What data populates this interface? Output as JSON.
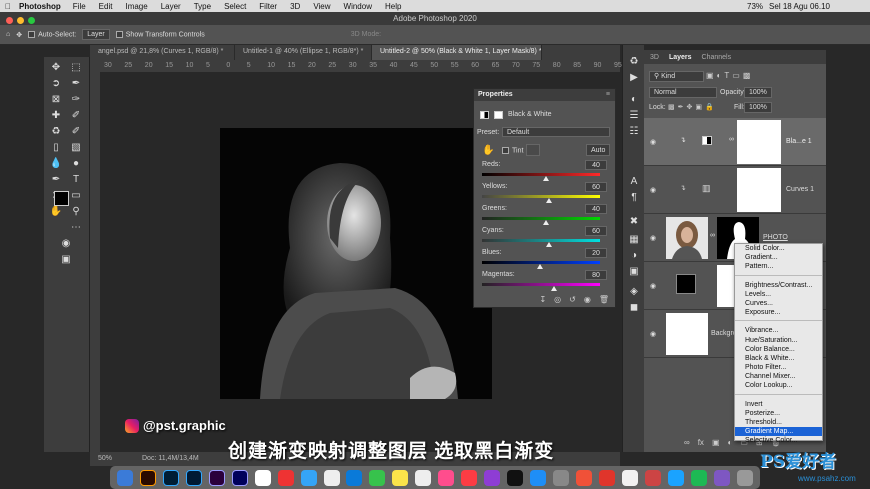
{
  "menubar": {
    "app": "Photoshop",
    "items": [
      "File",
      "Edit",
      "Image",
      "Layer",
      "Type",
      "Select",
      "Filter",
      "3D",
      "View",
      "Window",
      "Help"
    ],
    "battery": "73%",
    "datetime": "Sel 18 Agu 06.10"
  },
  "titlebar": "Adobe Photoshop 2020",
  "options": {
    "auto_select": "Auto-Select:",
    "layer_select": "Layer",
    "transform": "Show Transform Controls",
    "mode": "3D Mode:"
  },
  "tabs": [
    "angel.psd @ 21,8% (Curves 1, RGB/8) *",
    "Untitled-1 @ 40% (Ellipse 1, RGB/8*) *",
    "Untitled-2 @ 50% (Black & White 1, Layer Mask/8) *"
  ],
  "ruler": [
    "30",
    "25",
    "20",
    "15",
    "10",
    "5",
    "0",
    "5",
    "10",
    "15",
    "20",
    "25",
    "30",
    "35",
    "40",
    "45",
    "50",
    "55",
    "60",
    "65",
    "70",
    "75",
    "80",
    "85",
    "90",
    "95"
  ],
  "properties": {
    "title": "Properties",
    "adjustment": "Black & White",
    "preset_label": "Preset:",
    "preset_value": "Default",
    "tint": "Tint",
    "auto": "Auto",
    "sliders": [
      {
        "name": "Reds:",
        "value": "40"
      },
      {
        "name": "Yellows:",
        "value": "60"
      },
      {
        "name": "Greens:",
        "value": "40"
      },
      {
        "name": "Cyans:",
        "value": "60"
      },
      {
        "name": "Blues:",
        "value": "20"
      },
      {
        "name": "Magentas:",
        "value": "80"
      }
    ],
    "slider_fraction": [
      0.54,
      0.57,
      0.54,
      0.57,
      0.49,
      0.61
    ]
  },
  "layers": {
    "tab3d": "3D",
    "tab_layers": "Layers",
    "tab_channels": "Channels",
    "kind": "Kind",
    "blend": "Normal",
    "opacity_label": "Opacity:",
    "opacity": "100%",
    "lock": "Lock:",
    "fill_label": "Fill:",
    "fill": "100%",
    "rows": [
      {
        "name": "Bla...e 1"
      },
      {
        "name": "Curves 1"
      },
      {
        "name": "PHOTO"
      },
      {
        "name": ""
      },
      {
        "name": "Backgro"
      }
    ]
  },
  "context_menu": {
    "items": [
      "Solid Color...",
      "Gradient...",
      "Pattern...",
      "-",
      "Brightness/Contrast...",
      "Levels...",
      "Curves...",
      "Exposure...",
      "-",
      "Vibrance...",
      "Hue/Saturation...",
      "Color Balance...",
      "Black & White...",
      "Photo Filter...",
      "Channel Mixer...",
      "Color Lookup...",
      "-",
      "Invert",
      "Posterize...",
      "Threshold...",
      "Gradient Map...",
      "Selective Color..."
    ],
    "highlighted": "Gradient Map..."
  },
  "status": {
    "zoom": "50%",
    "doc": "Doc: 11,4M/13,4M"
  },
  "overlay": {
    "instagram": "@pst.graphic",
    "subtitle": "创建渐变映射调整图层 选取黑白渐变",
    "watermark": "PS爱好者",
    "watermark_url": "www.psahz.com"
  }
}
